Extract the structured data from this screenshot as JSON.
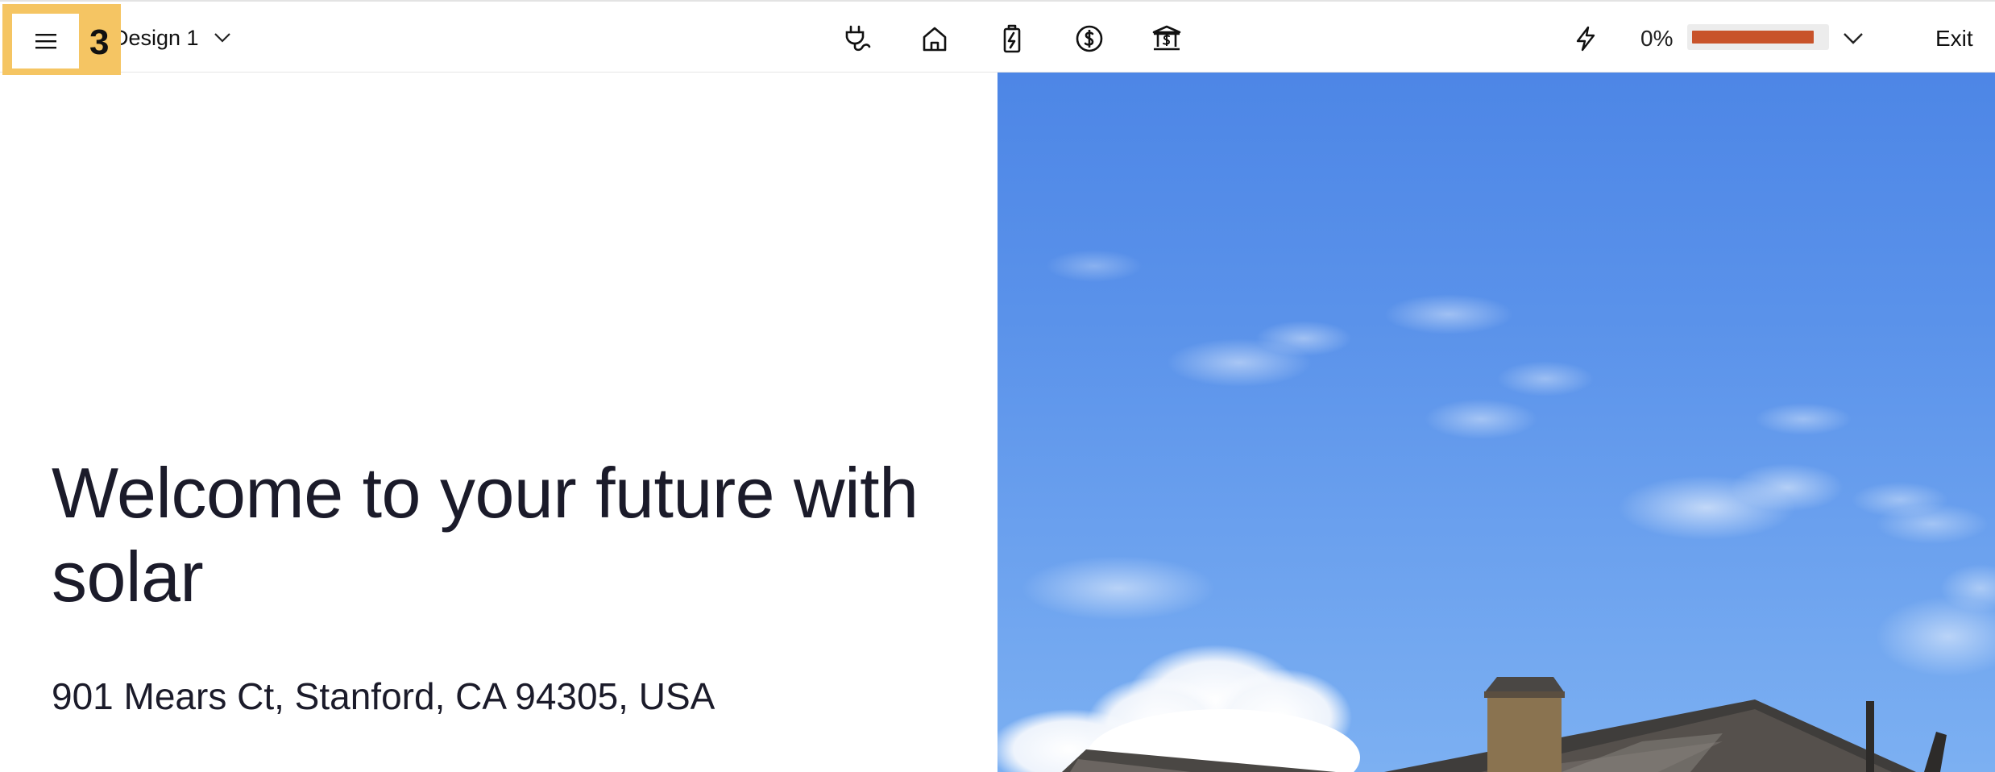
{
  "header": {
    "badge": "3",
    "design_label": "Design 1",
    "progress_percent_label": "0%",
    "progress_fraction": 0.92,
    "exit_label": "Exit",
    "nav_icons": [
      "plug-icon",
      "home-icon",
      "battery-charging-icon",
      "dollar-circle-icon",
      "bank-dollar-icon"
    ]
  },
  "main": {
    "headline": "Welcome to your future with solar",
    "address": "901 Mears Ct, Stanford, CA 94305, USA"
  },
  "colors": {
    "highlight": "#f5c563",
    "progress": "#c8532a",
    "sky": "#5a92ea"
  }
}
